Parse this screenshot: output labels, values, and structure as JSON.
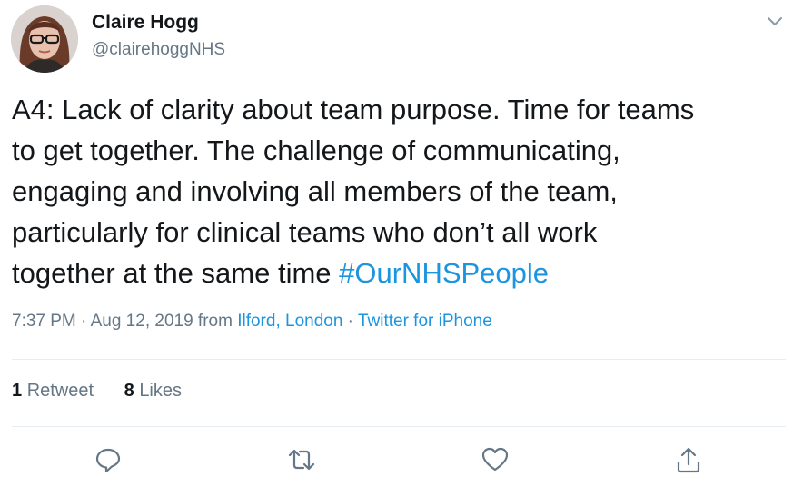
{
  "author": {
    "name": "Claire Hogg",
    "handle": "@clairehoggNHS"
  },
  "tweet": {
    "text_before": "A4: Lack of clarity about team purpose. Time for teams\nto get together.  The challenge of communicating,\nengaging and involving all members of the team,\nparticularly for clinical teams who don’t all work\ntogether at the same time ",
    "hashtag": "#OurNHSPeople"
  },
  "meta": {
    "time_date": "7:37 PM · Aug 12, 2019 from ",
    "location": "Ilford, London",
    "separator": " · ",
    "source": "Twitter for iPhone"
  },
  "stats": {
    "retweets_count": "1",
    "retweets_label": "Retweet",
    "likes_count": "8",
    "likes_label": "Likes"
  },
  "icons": {
    "caret": "chevron-down-icon",
    "reply": "reply-icon",
    "retweet": "retweet-icon",
    "like": "heart-icon",
    "share": "share-icon"
  },
  "colors": {
    "link": "#1b95e0",
    "secondary_text": "#657786",
    "primary_text": "#14171a",
    "divider": "#e6ecf0"
  }
}
